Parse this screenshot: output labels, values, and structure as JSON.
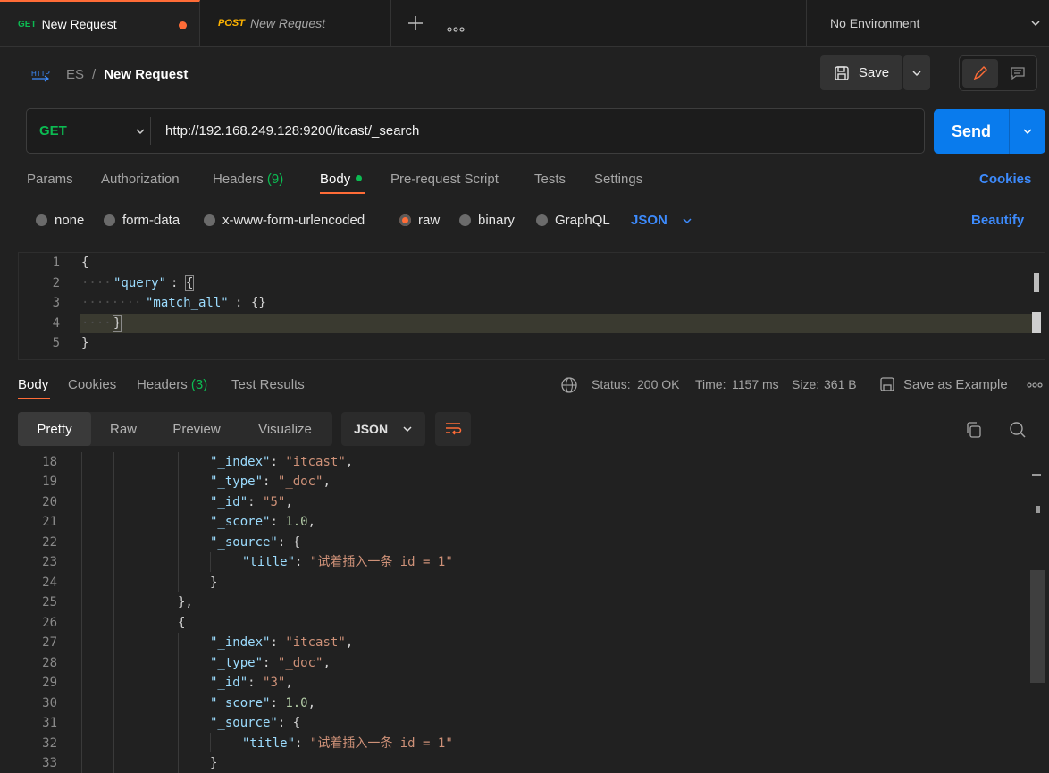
{
  "tabs": [
    {
      "method": "GET",
      "title": "New Request"
    },
    {
      "method": "POST",
      "title": "New Request"
    }
  ],
  "environment": "No Environment",
  "breadcrumb": {
    "collection": "ES",
    "separator": "/",
    "request": "New Request"
  },
  "save_label": "Save",
  "request": {
    "method": "GET",
    "url": "http://192.168.249.128:9200/itcast/_search",
    "send_label": "Send"
  },
  "request_tabs": {
    "params": "Params",
    "authorization": "Authorization",
    "headers": "Headers",
    "headers_count": "(9)",
    "body": "Body",
    "prerequest": "Pre-request Script",
    "tests": "Tests",
    "settings": "Settings",
    "cookies": "Cookies"
  },
  "body_modes": {
    "none": "none",
    "form_data": "form-data",
    "urlencoded": "x-www-form-urlencoded",
    "raw": "raw",
    "binary": "binary",
    "graphql": "GraphQL",
    "language": "JSON",
    "beautify": "Beautify",
    "selected": "raw"
  },
  "request_body": {
    "line_numbers": [
      "1",
      "2",
      "3",
      "4",
      "5"
    ],
    "open_brace": "{",
    "query_key": "\"query\"",
    "colon": ":",
    "match_all_key": "\"match_all\"",
    "empty_obj": "{}",
    "inner_close": "}",
    "outer_close": "}"
  },
  "response_tabs": {
    "body": "Body",
    "cookies": "Cookies",
    "headers": "Headers",
    "headers_count": "(3)",
    "test_results": "Test Results"
  },
  "response_meta": {
    "status_label": "Status:",
    "status_value": "200 OK",
    "time_label": "Time:",
    "time_value": "1157 ms",
    "size_label": "Size:",
    "size_value": "361 B",
    "save_example": "Save as Example"
  },
  "response_formats": {
    "pretty": "Pretty",
    "raw": "Raw",
    "preview": "Preview",
    "visualize": "Visualize",
    "language": "JSON",
    "selected": "Pretty"
  },
  "response_body": {
    "line_numbers": [
      "18",
      "19",
      "20",
      "21",
      "22",
      "23",
      "24",
      "25",
      "26",
      "27",
      "28",
      "29",
      "30",
      "31",
      "32",
      "33"
    ],
    "index_key": "\"_index\"",
    "index_val": "\"itcast\"",
    "type_key": "\"_type\"",
    "type_val": "\"_doc\"",
    "id_key": "\"_id\"",
    "id_val_1": "\"5\"",
    "id_val_2": "\"3\"",
    "score_key": "\"_score\"",
    "score_val": "1.0",
    "source_key": "\"_source\"",
    "title_key": "\"title\"",
    "title_val": "\"试着插入一条 id = 1\"",
    "open_brace": "{",
    "close_brace": "}",
    "close_obj_comma": "},",
    "comma": ",",
    "colon": ":"
  },
  "colors": {
    "accent": "#ff6c37",
    "send": "#097bed",
    "get": "#0cbb52",
    "post": "#ffb400",
    "link": "#3d8bfd"
  }
}
